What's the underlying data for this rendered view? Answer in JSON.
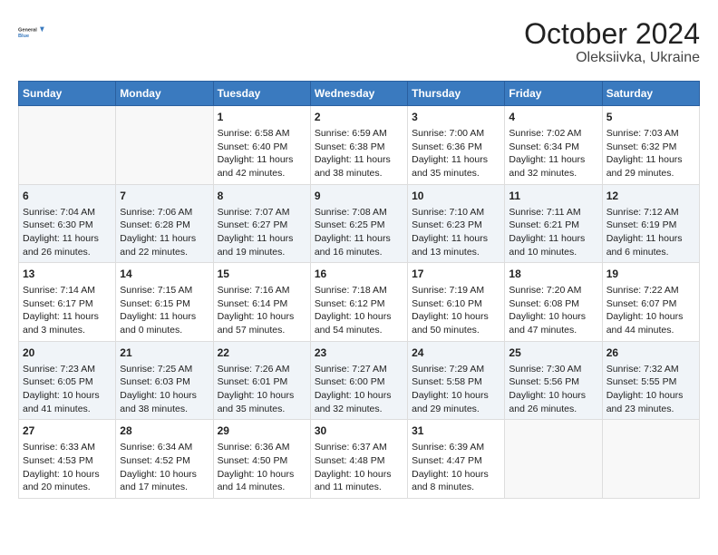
{
  "logo": {
    "line1": "General",
    "line2": "Blue"
  },
  "title": "October 2024",
  "subtitle": "Oleksiivka, Ukraine",
  "days_of_week": [
    "Sunday",
    "Monday",
    "Tuesday",
    "Wednesday",
    "Thursday",
    "Friday",
    "Saturday"
  ],
  "weeks": [
    [
      {
        "day": "",
        "sunrise": "",
        "sunset": "",
        "daylight": ""
      },
      {
        "day": "",
        "sunrise": "",
        "sunset": "",
        "daylight": ""
      },
      {
        "day": "1",
        "sunrise": "Sunrise: 6:58 AM",
        "sunset": "Sunset: 6:40 PM",
        "daylight": "Daylight: 11 hours and 42 minutes."
      },
      {
        "day": "2",
        "sunrise": "Sunrise: 6:59 AM",
        "sunset": "Sunset: 6:38 PM",
        "daylight": "Daylight: 11 hours and 38 minutes."
      },
      {
        "day": "3",
        "sunrise": "Sunrise: 7:00 AM",
        "sunset": "Sunset: 6:36 PM",
        "daylight": "Daylight: 11 hours and 35 minutes."
      },
      {
        "day": "4",
        "sunrise": "Sunrise: 7:02 AM",
        "sunset": "Sunset: 6:34 PM",
        "daylight": "Daylight: 11 hours and 32 minutes."
      },
      {
        "day": "5",
        "sunrise": "Sunrise: 7:03 AM",
        "sunset": "Sunset: 6:32 PM",
        "daylight": "Daylight: 11 hours and 29 minutes."
      }
    ],
    [
      {
        "day": "6",
        "sunrise": "Sunrise: 7:04 AM",
        "sunset": "Sunset: 6:30 PM",
        "daylight": "Daylight: 11 hours and 26 minutes."
      },
      {
        "day": "7",
        "sunrise": "Sunrise: 7:06 AM",
        "sunset": "Sunset: 6:28 PM",
        "daylight": "Daylight: 11 hours and 22 minutes."
      },
      {
        "day": "8",
        "sunrise": "Sunrise: 7:07 AM",
        "sunset": "Sunset: 6:27 PM",
        "daylight": "Daylight: 11 hours and 19 minutes."
      },
      {
        "day": "9",
        "sunrise": "Sunrise: 7:08 AM",
        "sunset": "Sunset: 6:25 PM",
        "daylight": "Daylight: 11 hours and 16 minutes."
      },
      {
        "day": "10",
        "sunrise": "Sunrise: 7:10 AM",
        "sunset": "Sunset: 6:23 PM",
        "daylight": "Daylight: 11 hours and 13 minutes."
      },
      {
        "day": "11",
        "sunrise": "Sunrise: 7:11 AM",
        "sunset": "Sunset: 6:21 PM",
        "daylight": "Daylight: 11 hours and 10 minutes."
      },
      {
        "day": "12",
        "sunrise": "Sunrise: 7:12 AM",
        "sunset": "Sunset: 6:19 PM",
        "daylight": "Daylight: 11 hours and 6 minutes."
      }
    ],
    [
      {
        "day": "13",
        "sunrise": "Sunrise: 7:14 AM",
        "sunset": "Sunset: 6:17 PM",
        "daylight": "Daylight: 11 hours and 3 minutes."
      },
      {
        "day": "14",
        "sunrise": "Sunrise: 7:15 AM",
        "sunset": "Sunset: 6:15 PM",
        "daylight": "Daylight: 11 hours and 0 minutes."
      },
      {
        "day": "15",
        "sunrise": "Sunrise: 7:16 AM",
        "sunset": "Sunset: 6:14 PM",
        "daylight": "Daylight: 10 hours and 57 minutes."
      },
      {
        "day": "16",
        "sunrise": "Sunrise: 7:18 AM",
        "sunset": "Sunset: 6:12 PM",
        "daylight": "Daylight: 10 hours and 54 minutes."
      },
      {
        "day": "17",
        "sunrise": "Sunrise: 7:19 AM",
        "sunset": "Sunset: 6:10 PM",
        "daylight": "Daylight: 10 hours and 50 minutes."
      },
      {
        "day": "18",
        "sunrise": "Sunrise: 7:20 AM",
        "sunset": "Sunset: 6:08 PM",
        "daylight": "Daylight: 10 hours and 47 minutes."
      },
      {
        "day": "19",
        "sunrise": "Sunrise: 7:22 AM",
        "sunset": "Sunset: 6:07 PM",
        "daylight": "Daylight: 10 hours and 44 minutes."
      }
    ],
    [
      {
        "day": "20",
        "sunrise": "Sunrise: 7:23 AM",
        "sunset": "Sunset: 6:05 PM",
        "daylight": "Daylight: 10 hours and 41 minutes."
      },
      {
        "day": "21",
        "sunrise": "Sunrise: 7:25 AM",
        "sunset": "Sunset: 6:03 PM",
        "daylight": "Daylight: 10 hours and 38 minutes."
      },
      {
        "day": "22",
        "sunrise": "Sunrise: 7:26 AM",
        "sunset": "Sunset: 6:01 PM",
        "daylight": "Daylight: 10 hours and 35 minutes."
      },
      {
        "day": "23",
        "sunrise": "Sunrise: 7:27 AM",
        "sunset": "Sunset: 6:00 PM",
        "daylight": "Daylight: 10 hours and 32 minutes."
      },
      {
        "day": "24",
        "sunrise": "Sunrise: 7:29 AM",
        "sunset": "Sunset: 5:58 PM",
        "daylight": "Daylight: 10 hours and 29 minutes."
      },
      {
        "day": "25",
        "sunrise": "Sunrise: 7:30 AM",
        "sunset": "Sunset: 5:56 PM",
        "daylight": "Daylight: 10 hours and 26 minutes."
      },
      {
        "day": "26",
        "sunrise": "Sunrise: 7:32 AM",
        "sunset": "Sunset: 5:55 PM",
        "daylight": "Daylight: 10 hours and 23 minutes."
      }
    ],
    [
      {
        "day": "27",
        "sunrise": "Sunrise: 6:33 AM",
        "sunset": "Sunset: 4:53 PM",
        "daylight": "Daylight: 10 hours and 20 minutes."
      },
      {
        "day": "28",
        "sunrise": "Sunrise: 6:34 AM",
        "sunset": "Sunset: 4:52 PM",
        "daylight": "Daylight: 10 hours and 17 minutes."
      },
      {
        "day": "29",
        "sunrise": "Sunrise: 6:36 AM",
        "sunset": "Sunset: 4:50 PM",
        "daylight": "Daylight: 10 hours and 14 minutes."
      },
      {
        "day": "30",
        "sunrise": "Sunrise: 6:37 AM",
        "sunset": "Sunset: 4:48 PM",
        "daylight": "Daylight: 10 hours and 11 minutes."
      },
      {
        "day": "31",
        "sunrise": "Sunrise: 6:39 AM",
        "sunset": "Sunset: 4:47 PM",
        "daylight": "Daylight: 10 hours and 8 minutes."
      },
      {
        "day": "",
        "sunrise": "",
        "sunset": "",
        "daylight": ""
      },
      {
        "day": "",
        "sunrise": "",
        "sunset": "",
        "daylight": ""
      }
    ]
  ]
}
